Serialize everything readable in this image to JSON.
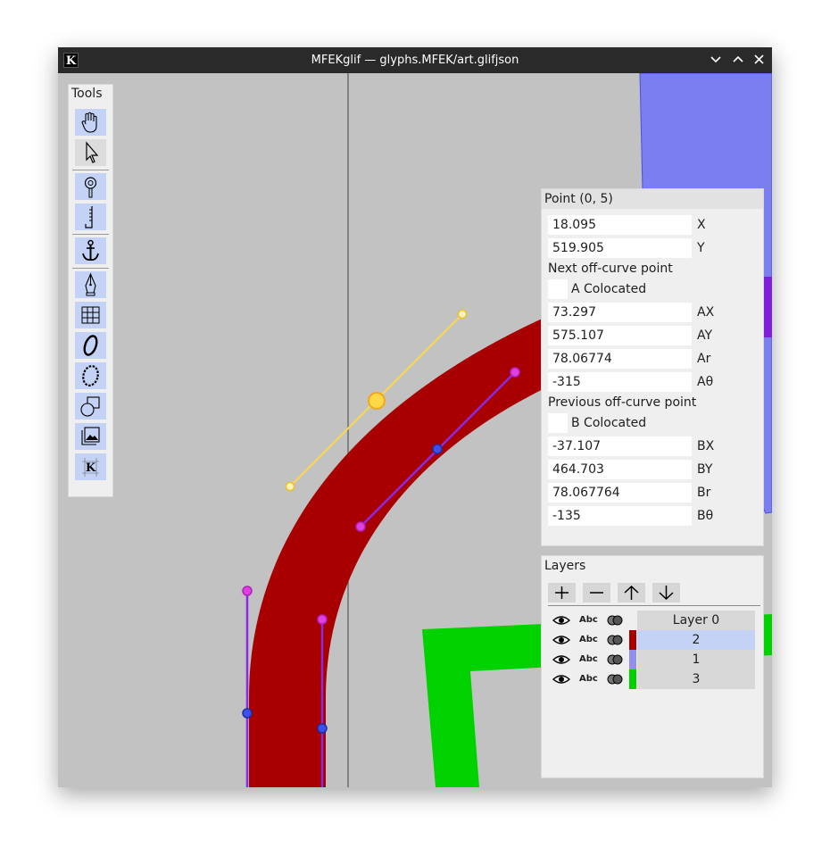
{
  "window": {
    "title": "MFEKglif — glyphs.MFEK/art.glifjson",
    "logo_letter": "K",
    "controls": [
      "chevron-down-icon",
      "chevron-up-icon",
      "close-icon"
    ]
  },
  "tools_panel": {
    "title": "Tools",
    "tools": [
      {
        "name": "pan-tool",
        "icon": "hand-icon"
      },
      {
        "name": "select-tool",
        "icon": "arrow-pointer-icon"
      },
      {
        "name": "zoom-tool",
        "icon": "magnifier-icon"
      },
      {
        "name": "measure-tool",
        "icon": "ruler-icon"
      },
      {
        "name": "anchor-tool",
        "icon": "anchor-icon"
      },
      {
        "name": "pen-tool",
        "icon": "pen-nib-icon"
      },
      {
        "name": "guidelines-tool",
        "icon": "grid-icon"
      },
      {
        "name": "variable-width-stroke-tool",
        "icon": "italic-o-icon"
      },
      {
        "name": "pattern-along-path-tool",
        "icon": "chain-o-icon"
      },
      {
        "name": "shapes-tool",
        "icon": "shapes-icon"
      },
      {
        "name": "image-tool",
        "icon": "image-icon"
      },
      {
        "name": "guideline-k-tool",
        "icon": "k-grid-icon"
      }
    ],
    "active_tool": "select-tool"
  },
  "point_panel": {
    "title": "Point (0, 5)",
    "x": {
      "value": "18.095",
      "label": "X"
    },
    "y": {
      "value": "519.905",
      "label": "Y"
    },
    "next_header": "Next off-curve point",
    "next_colocated": "A Colocated",
    "ax": {
      "value": "73.297",
      "label": "AX"
    },
    "ay": {
      "value": "575.107",
      "label": "AY"
    },
    "ar": {
      "value": "78.06774",
      "label": "Ar"
    },
    "atheta": {
      "value": "-315",
      "label": "Aθ"
    },
    "prev_header": "Previous off-curve point",
    "prev_colocated": "B Colocated",
    "bx": {
      "value": "-37.107",
      "label": "BX"
    },
    "by": {
      "value": "464.703",
      "label": "BY"
    },
    "br": {
      "value": "78.067764",
      "label": "Br"
    },
    "btheta": {
      "value": "-135",
      "label": "Bθ"
    }
  },
  "layers_panel": {
    "title": "Layers",
    "buttons": [
      "add-layer",
      "remove-layer",
      "move-layer-up",
      "move-layer-down"
    ],
    "rows": [
      {
        "name": "Layer 0",
        "abc": "Abc",
        "color": "",
        "selected": false
      },
      {
        "name": "2",
        "abc": "Abc",
        "color": "#a80000",
        "selected": true
      },
      {
        "name": "1",
        "abc": "Abc",
        "color": "#8f8fee",
        "selected": false
      },
      {
        "name": "3",
        "abc": "Abc",
        "color": "#00d200",
        "selected": false
      }
    ]
  },
  "colors": {
    "canvas": "#c2c2c2",
    "layer_red": "#a80000",
    "layer_green": "#00d200",
    "layer_blue": "#7a7ef0",
    "handle_selected": "#ffd84a",
    "handle_purple": "#8a2be2",
    "point_magenta": "#e040e0",
    "point_blue": "#3a50f0"
  }
}
